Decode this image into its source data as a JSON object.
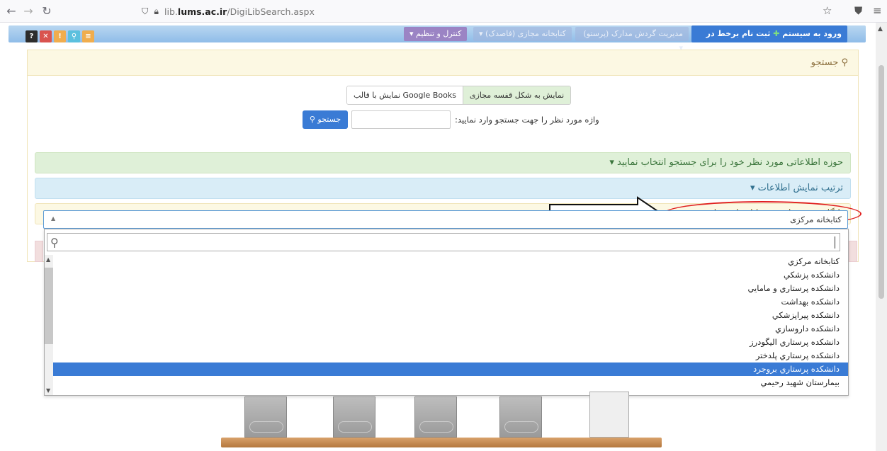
{
  "browser": {
    "url_domain": "lib.",
    "url_bold": "lums.ac.ir",
    "url_path": "/DigiLibSearch.aspx"
  },
  "topbar": {
    "mini_buttons": [
      "?",
      "✕",
      "!",
      "⚲",
      "≡"
    ],
    "menu_control": "کنترل و تنظیم ▾",
    "menu_virtual": "کتابخانه مجازی (فاصدک) ▾",
    "menu_circulation": "مدیریت گردش مدارک (پرستو) ▾",
    "login_text": "ورود به سیستم",
    "register_text": "ثبت نام برخط در کتابخانه"
  },
  "search_panel": {
    "title": "جستجو",
    "toggle_google": "نمایش با قالب Google Books",
    "toggle_virtual": "نمایش به شکل قفسه مجازی",
    "query_label": "واژه مورد نظر را جهت جستجو وارد نمایید:",
    "search_button": "جستجو",
    "field_bar": "حوزه اطلاعاتی مورد نظر خود را برای جستجو انتخاب نمایید ▾",
    "order_bar": "ترتیب نمایش اطلاعات ▾",
    "database_bar": "پایگاه مورد نظر خود را انتخاب نمایید ▾"
  },
  "select": {
    "value": "کتابخانه مرکزی",
    "options": [
      "کتابخانه مرکزي",
      "دانشکده پزشکي",
      "دانشکده پرستاري و مامايي",
      "دانشکده بهداشت",
      "دانشکده پيراپزشکي",
      "دانشکده داروسازي",
      "دانشکده پرستاري اليگودرز",
      "دانشکده پرستاري پلدختر",
      "دانشکده پرستاري بروجرد",
      "بيمارستان شهيد رحيمي"
    ],
    "selected_index": 8
  },
  "colors": {
    "accent": "#3a7bd5",
    "annotation_red": "#e02020"
  }
}
